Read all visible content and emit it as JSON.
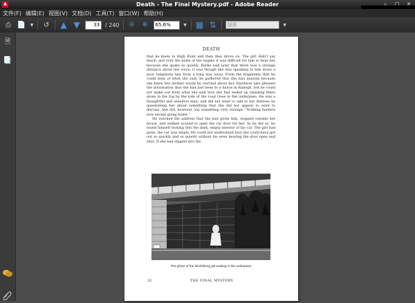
{
  "window": {
    "title": "Death - The Final Mystery.pdf - Adobe Reader"
  },
  "menu": [
    "文件(F)",
    "编辑(E)",
    "视图(V)",
    "文档(D)",
    "工具(T)",
    "窗口(W)",
    "帮助(H)"
  ],
  "toolbar": {
    "current_page": "33",
    "total_pages": "/ 240",
    "zoom": "65.6%",
    "search_placeholder": "搜索"
  },
  "document": {
    "running_head": "DEATH",
    "paragraphs": [
      "that he knew in High Point and then they drove on. The girl didn't say much, and over the noise of the engine it was difficult for him to hear her because she spoke so quietly. Burke said later that there was a strange distance about her voice: it was though she was speaking to him down a poor telephone line from a long way away. From the fragments that he could hear of what she said, he gathered that she was anxious because she knew her mother would be worried about her. Hardison also gleaned the information that she had just been to a dance in Raleigh, but he could not make out from what she said how she had ended up standing there alone in the fog by the side of the road close to the underpass. He was a thoughtful and sensitive man, and did not want to add to her distress by questioning her about something that she did not appear to want to discuss. She did, however, say something very strange: \"Nothing matters now except going home.\"",
      "He reached the address that the had given him, stopped outside her house, and walked around to open the car door for her. As he did so, he found himself looking into the dark, empty interior of his car. The girl had gone; the car was empty. He could not understand how she could have got out so quickly and so quietly without his even hearing the door open and shut. If she had slipped into the"
    ],
    "caption": "The ghost of the hitchhiking girl waiting in the underpass.",
    "folio": "32",
    "footer_title": "THE FINAL MYSTERY"
  }
}
